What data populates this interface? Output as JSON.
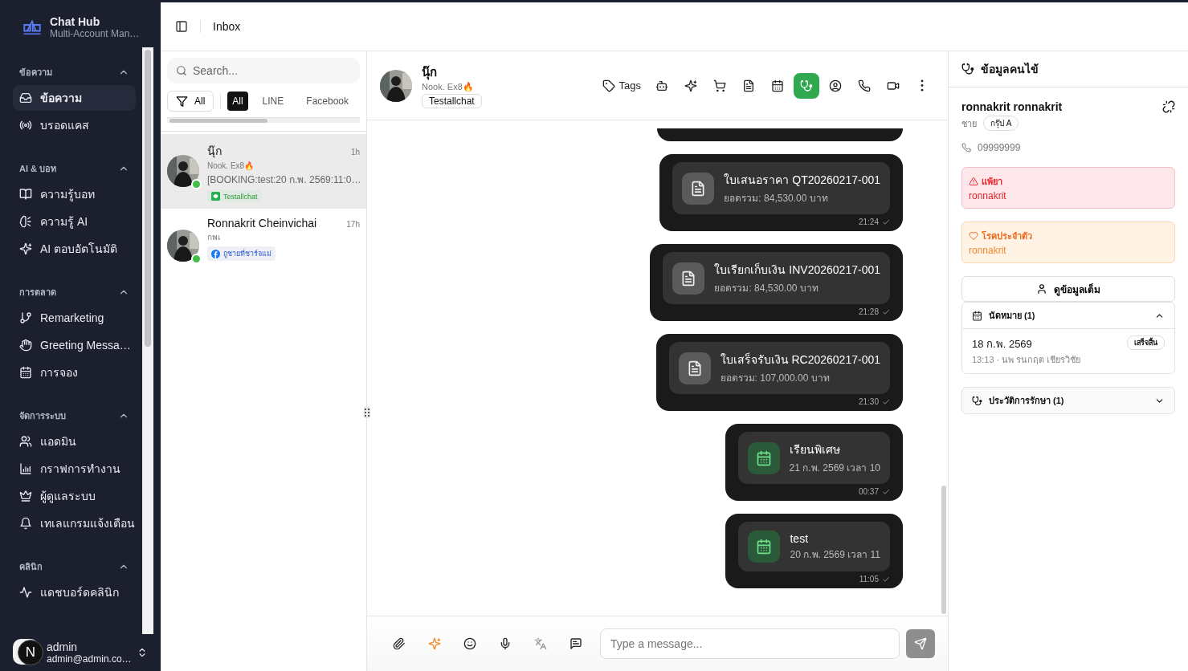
{
  "app": {
    "name": "Chat Hub",
    "subtitle": "Multi-Account Man…"
  },
  "nav": [
    {
      "title": "ข้อความ",
      "expanded": true,
      "items": [
        {
          "label": "ข้อความ",
          "selected": true
        },
        {
          "label": "บรอดแคส",
          "selected": false
        }
      ]
    },
    {
      "title": "AI & บอท",
      "expanded": true,
      "items": [
        {
          "label": "ความรู้บอท",
          "selected": false
        },
        {
          "label": "ความรู้ AI",
          "selected": false
        },
        {
          "label": "AI ตอบอัตโนมัติ",
          "selected": false
        }
      ]
    },
    {
      "title": "การตลาด",
      "expanded": true,
      "items": [
        {
          "label": "Remarketing",
          "selected": false
        },
        {
          "label": "Greeting Messa…",
          "selected": false
        },
        {
          "label": "การจอง",
          "selected": false
        }
      ]
    },
    {
      "title": "จัดการระบบ",
      "expanded": true,
      "items": [
        {
          "label": "แอดมิน",
          "selected": false
        },
        {
          "label": "กราฟการทำงาน",
          "selected": false
        },
        {
          "label": "ผู้ดูแลระบบ",
          "selected": false
        },
        {
          "label": "เทเลแกรมแจ้งเตือน",
          "selected": false
        }
      ]
    },
    {
      "title": "คลินิก",
      "expanded": true,
      "items": [
        {
          "label": "แดชบอร์ดคลินิก",
          "selected": false
        }
      ]
    }
  ],
  "user": {
    "initial": "N",
    "name": "admin",
    "email": "admin@admin.co…"
  },
  "header": {
    "title": "Inbox"
  },
  "conversation_list": {
    "search": {
      "placeholder": "Search..."
    },
    "filter": {
      "label": "All"
    },
    "channel_tabs": [
      {
        "label": "All",
        "selected": true
      },
      {
        "label": "LINE",
        "selected": false
      },
      {
        "label": "Facebook",
        "selected": false
      }
    ],
    "conversations": [
      {
        "name": "นุ๊ก",
        "subtitle": "Nook. Ex8🔥",
        "preview": "[BOOKING:test:20 ก.พ. 2569:11:0…",
        "time": "1h",
        "tag": {
          "label": "Testallchat",
          "kind": "line"
        },
        "online": true,
        "selected": true
      },
      {
        "name": "Ronnakrit Cheinvichai",
        "subtitle": "กพเ",
        "time": "17h",
        "tag": {
          "label": "ถูชายที่ชาร์จแม่",
          "kind": "facebook"
        },
        "online": true,
        "selected": false
      }
    ]
  },
  "chat": {
    "contact": {
      "name": "นุ๊ก",
      "subtitle": "Nook. Ex8🔥",
      "tag": "Testallchat"
    },
    "toolbar": [
      {
        "label": "Tags",
        "selected": false
      },
      {
        "selected": false
      },
      {
        "selected": false
      },
      {
        "selected": false
      },
      {
        "selected": false
      },
      {
        "selected": false
      },
      {
        "selected": true
      },
      {
        "selected": false
      },
      {
        "selected": false
      },
      {
        "selected": false
      },
      {
        "selected": false
      }
    ],
    "messages": [
      {
        "kind": "document",
        "title": "ใบเสนอราคา QT20260217-001",
        "subtitle": "ยอดรวม: 84,530.00 บาท",
        "time": "21:24",
        "delivered": true
      },
      {
        "kind": "document",
        "title": "ใบเรียกเก็บเงิน INV20260217-001",
        "subtitle": "ยอดรวม: 84,530.00 บาท",
        "time": "21:28",
        "delivered": true
      },
      {
        "kind": "document",
        "title": "ใบเสร็จรับเงิน RC20260217-001",
        "subtitle": "ยอดรวม: 107,000.00 บาท",
        "time": "21:30",
        "delivered": true
      },
      {
        "kind": "appointment",
        "title": "เรียนพิเศษ",
        "subtitle": "21 ก.พ. 2569 เวลา 10",
        "time": "00:37",
        "delivered": true
      },
      {
        "kind": "appointment",
        "title": "test",
        "subtitle": "20 ก.พ. 2569 เวลา 11",
        "time": "11:05",
        "delivered": true
      }
    ],
    "composer": {
      "tools": [
        {
          "disabled": false
        },
        {
          "disabled": false
        },
        {
          "disabled": false
        },
        {
          "disabled": false
        },
        {
          "disabled": true
        },
        {
          "disabled": false
        }
      ],
      "placeholder": "Type a message..."
    }
  },
  "patient": {
    "title": "ข้อมูลคนไข้",
    "name": "ronnakrit ronnakrit",
    "gender": "ชาย",
    "group": "กรุ๊ป A",
    "phone": "09999999",
    "alerts": [
      {
        "kind": "allergy",
        "title": "แพ้ยา",
        "value": "ronnakrit"
      },
      {
        "kind": "chronic",
        "title": "โรคประจำตัว",
        "value": "ronnakrit"
      }
    ],
    "full_info_button": "ดูข้อมูลเต็ม",
    "sections": [
      {
        "title": "นัดหมาย (1)",
        "expanded": true,
        "items": [
          {
            "date": "18 ก.พ. 2569",
            "detail": "13:13 · นพ รนกฤต เชียรวิชัย",
            "status": "เสร็จสิ้น"
          }
        ]
      },
      {
        "title": "ประวัติการรักษา (1)",
        "expanded": false
      }
    ]
  }
}
